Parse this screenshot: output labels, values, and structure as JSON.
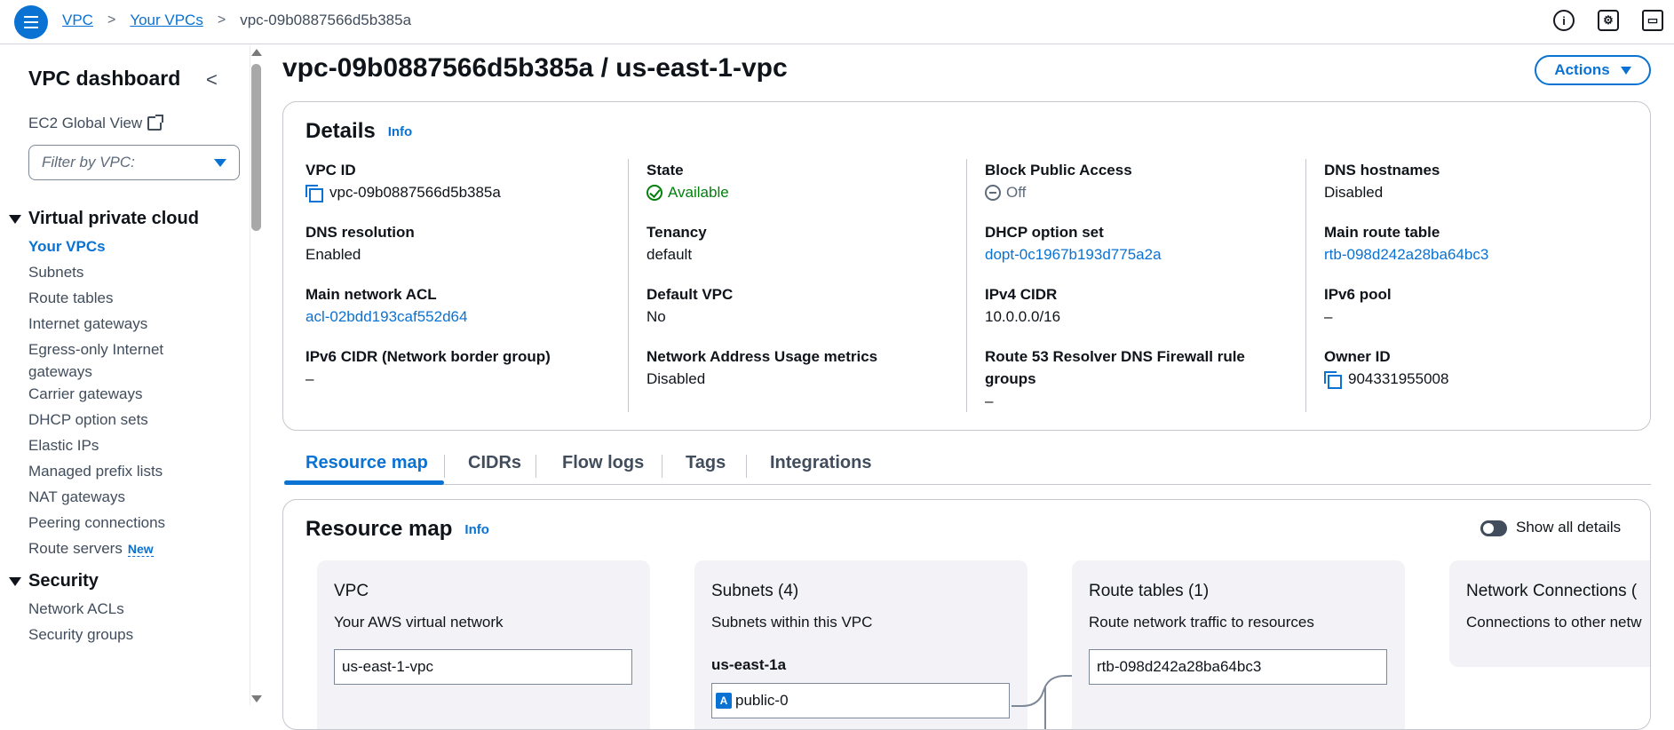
{
  "breadcrumb": {
    "items": [
      "VPC",
      "Your VPCs"
    ],
    "current": "vpc-09b0887566d5b385a"
  },
  "top_icons": [
    "info-icon",
    "settings-hex-icon",
    "monitor-icon"
  ],
  "sidebar": {
    "title": "VPC dashboard",
    "ec2_global_view": "EC2 Global View",
    "filter_placeholder": "Filter by VPC:",
    "sections": [
      {
        "title": "Virtual private cloud",
        "items": [
          {
            "label": "Your VPCs",
            "active": true
          },
          {
            "label": "Subnets"
          },
          {
            "label": "Route tables"
          },
          {
            "label": "Internet gateways"
          },
          {
            "label": "Egress-only Internet gateways"
          },
          {
            "label": "Carrier gateways"
          },
          {
            "label": "DHCP option sets"
          },
          {
            "label": "Elastic IPs"
          },
          {
            "label": "Managed prefix lists"
          },
          {
            "label": "NAT gateways"
          },
          {
            "label": "Peering connections"
          },
          {
            "label": "Route servers",
            "badge": "New"
          }
        ]
      },
      {
        "title": "Security",
        "items": [
          {
            "label": "Network ACLs"
          },
          {
            "label": "Security groups"
          }
        ]
      }
    ]
  },
  "page": {
    "title": "vpc-09b0887566d5b385a / us-east-1-vpc",
    "actions_label": "Actions"
  },
  "details": {
    "title": "Details",
    "info": "Info",
    "fields": {
      "vpc_id": {
        "label": "VPC ID",
        "value": "vpc-09b0887566d5b385a"
      },
      "state": {
        "label": "State",
        "value": "Available"
      },
      "block_public_access": {
        "label": "Block Public Access",
        "value": "Off"
      },
      "dns_hostnames": {
        "label": "DNS hostnames",
        "value": "Disabled"
      },
      "dns_resolution": {
        "label": "DNS resolution",
        "value": "Enabled"
      },
      "tenancy": {
        "label": "Tenancy",
        "value": "default"
      },
      "dhcp_option_set": {
        "label": "DHCP option set",
        "value": "dopt-0c1967b193d775a2a"
      },
      "main_route_table": {
        "label": "Main route table",
        "value": "rtb-098d242a28ba64bc3"
      },
      "main_network_acl": {
        "label": "Main network ACL",
        "value": "acl-02bdd193caf552d64"
      },
      "default_vpc": {
        "label": "Default VPC",
        "value": "No"
      },
      "ipv4_cidr": {
        "label": "IPv4 CIDR",
        "value": "10.0.0.0/16"
      },
      "ipv6_pool": {
        "label": "IPv6 pool",
        "value": "–"
      },
      "ipv6_cidr": {
        "label": "IPv6 CIDR (Network border group)",
        "value": "–"
      },
      "nau_metrics": {
        "label": "Network Address Usage metrics",
        "value": "Disabled"
      },
      "route53_firewall": {
        "label": "Route 53 Resolver DNS Firewall rule groups",
        "value": "–"
      },
      "owner_id": {
        "label": "Owner ID",
        "value": "904331955008"
      }
    }
  },
  "tabs": [
    "Resource map",
    "CIDRs",
    "Flow logs",
    "Tags",
    "Integrations"
  ],
  "resource_map": {
    "title": "Resource map",
    "info": "Info",
    "toggle_label": "Show all details",
    "columns": {
      "vpc": {
        "title": "VPC",
        "subtitle": "Your AWS virtual network",
        "box": "us-east-1-vpc"
      },
      "subnets": {
        "title": "Subnets (4)",
        "subtitle": "Subnets within this VPC",
        "az": "us-east-1a",
        "az_badge": "A",
        "first_subnet": "public-0"
      },
      "route_tables": {
        "title": "Route tables (1)",
        "subtitle": "Route network traffic to resources",
        "box": "rtb-098d242a28ba64bc3"
      },
      "network_connections": {
        "title": "Network Connections (",
        "subtitle": "Connections to other netw"
      }
    }
  },
  "colors": {
    "accent": "#0972d3",
    "success": "#037f0c",
    "text": "#0f141a",
    "muted": "#5f6b7a"
  }
}
